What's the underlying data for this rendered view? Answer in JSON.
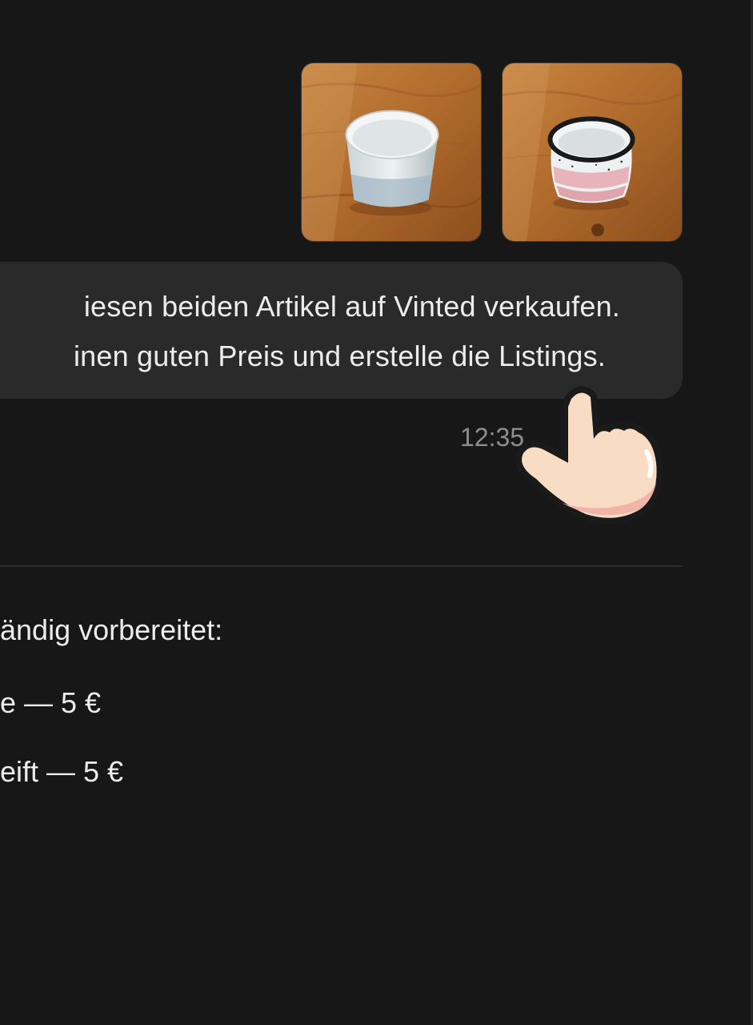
{
  "attachments": [
    {
      "icon": "photo-thumbnail",
      "description_colors": [
        "#b86d31",
        "#d2dadb"
      ]
    },
    {
      "icon": "photo-thumbnail",
      "description_colors": [
        "#b86d31",
        "#e8ecec"
      ]
    }
  ],
  "user_message": {
    "line_1": "iesen beiden Artikel auf Vinted verkaufen.",
    "line_2": "inen guten Preis und erstelle die Listings.",
    "timestamp": "12:35"
  },
  "assistant_reply": {
    "intro": "ändig vorbereitet:",
    "item_1": "e — 5 €",
    "item_2": "eift — 5 €"
  },
  "cursor": {
    "icon": "hand-pointer-icon"
  },
  "colors": {
    "background": "#171717",
    "bubble": "#2a2a2a",
    "text": "#ececec",
    "timestamp": "#8e8e8e"
  }
}
